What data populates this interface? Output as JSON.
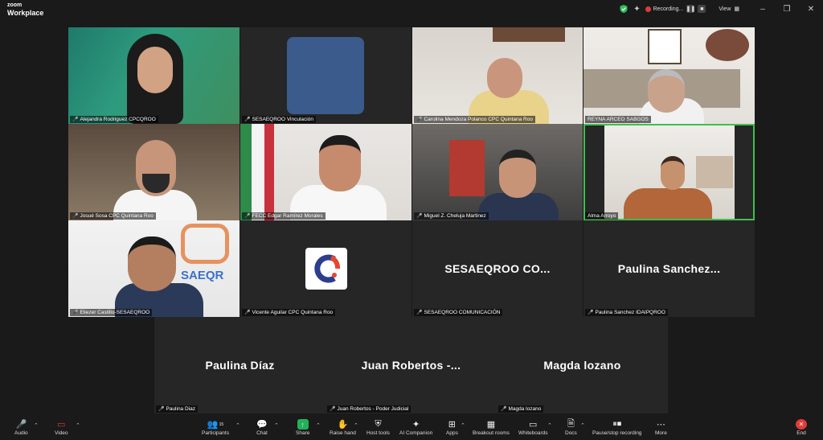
{
  "app": {
    "brand_top": "zoom",
    "brand_bottom": "Workplace"
  },
  "titlebar": {
    "recording_label": "Recording...",
    "view_label": "View"
  },
  "participants": [
    {
      "name": "Alejandra Rodriguez CPCQROO",
      "muted": true
    },
    {
      "name": "SESAEQROO Vinculación",
      "muted": true
    },
    {
      "name": "Carolina Mendoza Polanco CPC Quintana Roo",
      "muted": true
    },
    {
      "name": "REYNA ARCEO SABGOS",
      "muted": false
    },
    {
      "name": "Josué Sosa CPC Quintana Roo",
      "muted": true
    },
    {
      "name": "FECC Edgar Ramírez Morales",
      "muted": true
    },
    {
      "name": "Miguel Z. Cheluja Martinez",
      "muted": true
    },
    {
      "name": "Alma Arroyo",
      "muted": false
    },
    {
      "name": "Eliezer Castillo-SESAEQROO",
      "muted": true
    },
    {
      "name": "Vicente Aguilar CPC Quintana Roo",
      "muted": true
    },
    {
      "name": "SESAEQROO COMUNICACIÓN",
      "muted": true,
      "display": "SESAEQROO CO..."
    },
    {
      "name": "Paulina Sanchez IDAIPQROO",
      "muted": true,
      "display": "Paulina  Sanchez..."
    },
    {
      "name": "Paulina Diaz",
      "muted": true,
      "display": "Paulina Díaz"
    },
    {
      "name": "Juan Robertos - Poder Judicial",
      "muted": true,
      "display": "Juan  Robertos  -..."
    },
    {
      "name": "Magda lozano",
      "muted": true,
      "display": "Magda lozano"
    }
  ],
  "toolbar": {
    "audio": "Audio",
    "video": "Video",
    "participants": "Participants",
    "participants_count": "15",
    "chat": "Chat",
    "share": "Share",
    "raise_hand": "Raise hand",
    "host_tools": "Host tools",
    "ai_companion": "AI Companion",
    "apps": "Apps",
    "breakout_rooms": "Breakout rooms",
    "whiteboards": "Whiteboards",
    "docs": "Docs",
    "pause_stop_recording": "Pause/stop recording",
    "more": "More",
    "end": "End"
  },
  "colors": {
    "active_speaker": "#3fbf4f",
    "muted_icon": "#e03b3b",
    "share_green": "#23b05a",
    "end_red": "#e03b3b"
  }
}
